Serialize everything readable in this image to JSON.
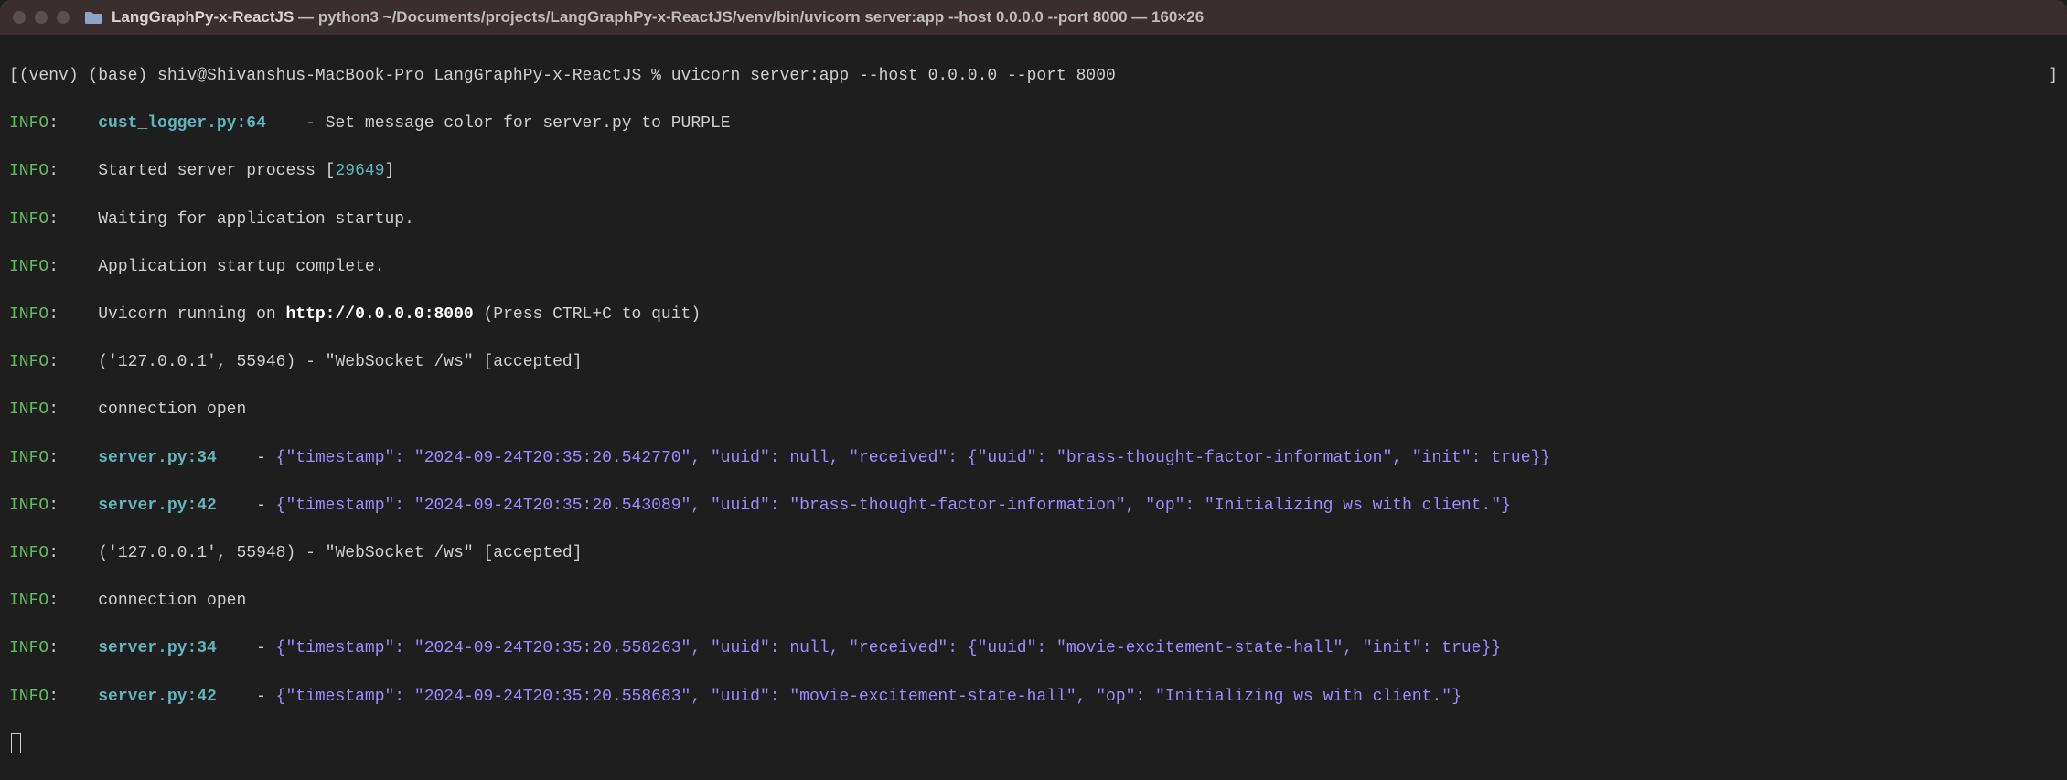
{
  "titlebar": {
    "app_folder": "LangGraphPy-x-ReactJS",
    "cmd": "python3 ~/Documents/projects/LangGraphPy-x-ReactJS/venv/bin/uvicorn server:app --host 0.0.0.0 --port 8000",
    "dims": "160×26"
  },
  "prompt": {
    "open_bracket": "[",
    "venv": "(venv) (base) shiv@Shivanshus-MacBook-Pro LangGraphPy-x-ReactJS % ",
    "command": "uvicorn server:app --host 0.0.0.0 --port 8000",
    "close_bracket": "]"
  },
  "info_label": "INFO",
  "colon_pad": ":    ",
  "lines": {
    "l1_src": "cust_logger.py:64",
    "l1_dash": "    - ",
    "l1_msg": "Set message color for server.py to PURPLE",
    "l2_a": "Started server process [",
    "l2_pid": "29649",
    "l2_b": "]",
    "l3": "Waiting for application startup.",
    "l4": "Application startup complete.",
    "l5_a": "Uvicorn running on ",
    "l5_url": "http://0.0.0.0:8000",
    "l5_b": " (Press CTRL+C to quit)",
    "l6": "('127.0.0.1', 55946) - \"WebSocket /ws\" [accepted]",
    "l7": "connection open",
    "l8_src": "server.py:34",
    "l8_dash": "    - ",
    "l8_json": "{\"timestamp\": \"2024-09-24T20:35:20.542770\", \"uuid\": null, \"received\": {\"uuid\": \"brass-thought-factor-information\", \"init\": true}}",
    "l9_src": "server.py:42",
    "l9_dash": "    - ",
    "l9_json": "{\"timestamp\": \"2024-09-24T20:35:20.543089\", \"uuid\": \"brass-thought-factor-information\", \"op\": \"Initializing ws with client.\"}",
    "l10": "('127.0.0.1', 55948) - \"WebSocket /ws\" [accepted]",
    "l11": "connection open",
    "l12_src": "server.py:34",
    "l12_dash": "    - ",
    "l12_json": "{\"timestamp\": \"2024-09-24T20:35:20.558263\", \"uuid\": null, \"received\": {\"uuid\": \"movie-excitement-state-hall\", \"init\": true}}",
    "l13_src": "server.py:42",
    "l13_dash": "    - ",
    "l13_json": "{\"timestamp\": \"2024-09-24T20:35:20.558683\", \"uuid\": \"movie-excitement-state-hall\", \"op\": \"Initializing ws with client.\"}"
  }
}
